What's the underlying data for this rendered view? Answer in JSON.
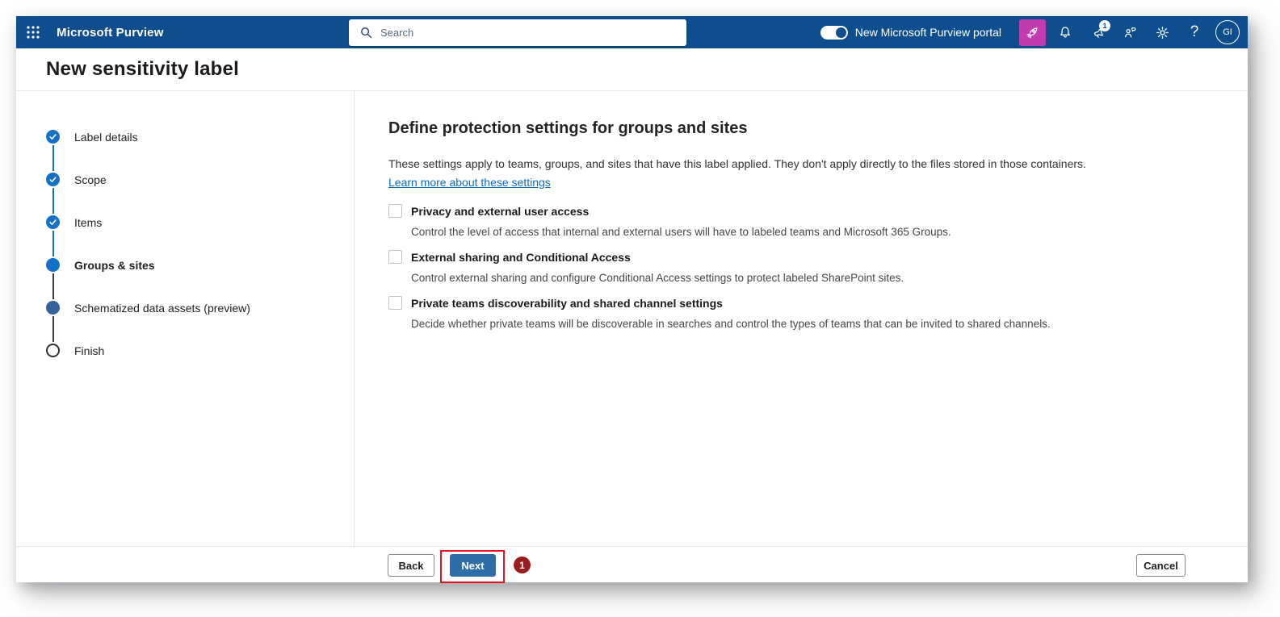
{
  "topbar": {
    "product": "Microsoft Purview",
    "search": {
      "placeholder": "Search"
    },
    "portal_toggle": {
      "label": "New Microsoft Purview portal",
      "state": "on"
    },
    "notification_badge": "1",
    "help_glyph": "?",
    "avatar_initials": "GI"
  },
  "page_title": "New sensitivity label",
  "wizard_steps": [
    {
      "label": "Label details",
      "state": "completed"
    },
    {
      "label": "Scope",
      "state": "completed"
    },
    {
      "label": "Items",
      "state": "completed"
    },
    {
      "label": "Groups & sites",
      "state": "current"
    },
    {
      "label": "Schematized data assets (preview)",
      "state": "upcoming-filled"
    },
    {
      "label": "Finish",
      "state": "upcoming"
    }
  ],
  "content": {
    "heading": "Define protection settings for groups and sites",
    "intro": "These settings apply to teams, groups, and sites that have this label applied. They don't apply directly to the files stored in those containers.",
    "learn_more_link": "Learn more about these settings",
    "options": [
      {
        "title": "Privacy and external user access",
        "description": "Control the level of access that internal and external users will have to labeled teams and Microsoft 365 Groups.",
        "checked": false
      },
      {
        "title": "External sharing and Conditional Access",
        "description": "Control external sharing and configure Conditional Access settings to protect labeled SharePoint sites.",
        "checked": false
      },
      {
        "title": "Private teams discoverability and shared channel settings",
        "description": "Decide whether private teams will be discoverable in searches and control the types of teams that can be invited to shared channels.",
        "checked": false
      }
    ]
  },
  "footer": {
    "back_label": "Back",
    "next_label": "Next",
    "cancel_label": "Cancel",
    "annotation_badge": "1"
  },
  "colors": {
    "topbar_blue": "#0e4e8f",
    "accent_magenta": "#c23cb0",
    "step_blue": "#1372c8",
    "step_muted_blue": "#35619c",
    "next_button_blue": "#2d6da8",
    "link_blue": "#0f6cbd",
    "annotation_red": "#e81123",
    "annotation_badge_red": "#9b1c1c"
  }
}
